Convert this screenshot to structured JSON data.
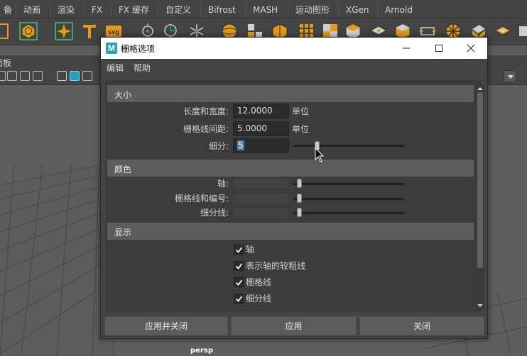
{
  "maya": {
    "menu_tabs": [
      "备",
      "动画",
      "渲染",
      "FX",
      "FX 缓存",
      "自定义",
      "Bifrost",
      "MASH",
      "运动图形",
      "XGen",
      "Arnold"
    ],
    "panel_label": "面板",
    "camera_label": "persp"
  },
  "dialog": {
    "title": "栅格选项",
    "app_icon_letter": "M",
    "menu": [
      "编辑",
      "帮助"
    ],
    "sections": {
      "size": {
        "title": "大小",
        "length_label": "长度和宽度:",
        "length_value": "12.0000",
        "length_unit": "单位",
        "spacing_label": "栅格线间距:",
        "spacing_value": "5.0000",
        "spacing_unit": "单位",
        "subdiv_label": "细分:",
        "subdiv_value": "5"
      },
      "color": {
        "title": "颜色",
        "axes_label": "轴:",
        "gridlines_label": "栅格线和编号:",
        "subdivlines_label": "细分线:"
      },
      "display": {
        "title": "显示",
        "checkboxes": [
          {
            "label": "轴",
            "checked": true
          },
          {
            "label": "表示轴的较粗线",
            "checked": true
          },
          {
            "label": "栅格线",
            "checked": true
          },
          {
            "label": "细分线",
            "checked": true
          }
        ]
      }
    },
    "buttons": {
      "apply_close": "应用并关闭",
      "apply": "应用",
      "close": "关闭"
    }
  },
  "icons": [
    "maya-icon",
    "minimize-icon",
    "maximize-icon",
    "close-icon",
    "checkmark-icon",
    "mouse-cursor-icon"
  ],
  "colors": {
    "dialog_bg": "#444444",
    "section_header": "#5d5d5d",
    "field_bg": "#2b2b2b",
    "selection": "#5285a6",
    "button_bg": "#5c5c5c",
    "accent_cyan": "#24a2b6"
  }
}
